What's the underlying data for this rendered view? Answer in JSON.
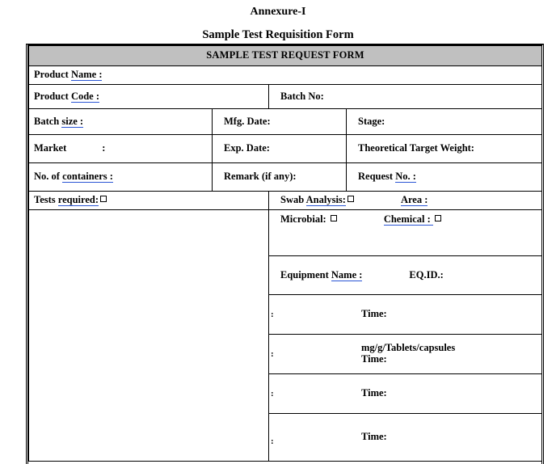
{
  "document": {
    "annexure_title": "Annexure-I",
    "form_title": "Sample Test Requisition Form",
    "table_header": "SAMPLE TEST REQUEST FORM"
  },
  "fields": {
    "product_name_label": "Product ",
    "product_name_spell": "Name  :",
    "product_code_label": "Product ",
    "product_code_spell": "Code :",
    "batch_no_label": "Batch No:",
    "batch_size_label": "Batch ",
    "batch_size_spell": "size :",
    "mfg_date_label": "Mfg. Date:",
    "stage_label": "Stage:",
    "market_label": "Market",
    "market_colon": ":",
    "exp_date_label": "Exp. Date:",
    "theoretical_target_weight_label": "Theoretical Target Weight:",
    "no_of_containers_label": "No. of ",
    "no_of_containers_spell": "containers :",
    "remark_label": "Remark (if any):",
    "request_no_label": "Request ",
    "request_no_spell": "No. :",
    "tests_required_label": "Tests ",
    "tests_required_spell": "required:",
    "swab_analysis_label": "Swab ",
    "swab_analysis_spell": "Analysis:",
    "area_label": "Area :",
    "microbial_label": "Microbial: ",
    "chemical_label": "Chemical : ",
    "equipment_name_label": "Equipment ",
    "equipment_name_spell": "Name  :",
    "eq_id_label": "EQ.ID.:",
    "time_label": "Time:",
    "unit_label": "mg/g/Tablets/capsules",
    "row_colon": ":"
  },
  "colors": {
    "header_background": "#c0c0c0",
    "spellcheck_underline": "#2a55d4",
    "border": "#000000",
    "text": "#000000",
    "page_background": "#ffffff"
  }
}
